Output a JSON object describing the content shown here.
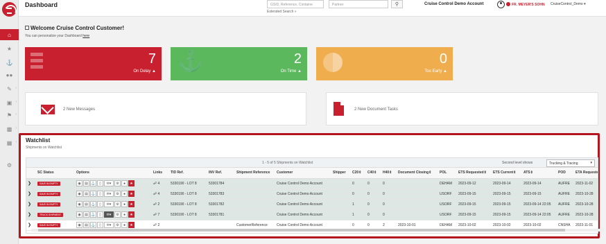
{
  "header": {
    "title": "Dashboard",
    "search_placeholder": "GSID, Reference, Containe",
    "partner_placeholder": "Partner",
    "extended_search": "Extended Search »",
    "account_name": "Cruise Control Demo Account",
    "brand": "FR. MEYER'S SOHN",
    "user": "CruiseControl_Demo"
  },
  "welcome": {
    "title": "Welcome Cruise Control Customer!",
    "subtitle": "You can personalize your Dashboard ",
    "link": "here"
  },
  "tiles": [
    {
      "value": "7",
      "label": "On Delay",
      "color": "#c8202f"
    },
    {
      "value": "2",
      "label": "On Time",
      "color": "#5cb85c"
    },
    {
      "value": "0",
      "label": "Too Early",
      "color": "#f0ad4e"
    }
  ],
  "messages": {
    "new_messages": "2 New Messages",
    "new_tasks": "2 New Document Tasks"
  },
  "watchlist": {
    "title": "Watchlist",
    "subtitle": "Shipments on Watchlist",
    "summary": "1 - 5 of 5 Shipments on Watchlist",
    "second_level_label": "Second level shows",
    "second_level_value": "Trucking & Tracing",
    "columns": [
      "SC Status",
      "Options",
      "Links",
      "TID Ref.",
      "INV Ref.",
      "Shipment Reference",
      "Customer",
      "Shipper",
      "C20⇕",
      "C40⇕",
      "H40⇕",
      "Document Closing⇕",
      "POL",
      "ETS Requested⇕",
      "ETS Current⇕",
      "ATS⇕",
      "POD",
      "ETA Requeste"
    ],
    "rows": [
      {
        "status": "SAVE IN EMPTY",
        "links": "4",
        "tid": "5330190 - LOT 8",
        "inv": "53301784",
        "shipment_ref": "",
        "customer": "Cruise Control Demo Account",
        "shipper": "",
        "c20": "0",
        "c40": "0",
        "h40": "0",
        "doc_closing": "",
        "pol": "DEHAM",
        "ets_req": "2023-09-12",
        "ets_cur": "2023-09-14",
        "ats": "2023-09-14",
        "pod": "AUFRE",
        "eta_req": "2023-11-02"
      },
      {
        "status": "SAVE IN EMPTY",
        "links": "4",
        "tid": "5330190 - LOT 8",
        "inv": "53301783",
        "shipment_ref": "",
        "customer": "Cruise Control Demo Account",
        "shipper": "",
        "c20": "0",
        "c40": "0",
        "h40": "0",
        "doc_closing": "",
        "pol": "USORF",
        "ets_req": "2023-09-15",
        "ets_cur": "2023-09-15",
        "ats": "2023-09-15",
        "pod": "AUFRE",
        "eta_req": "2023-10-28"
      },
      {
        "status": "SAVE IN EMPTY",
        "links": "2",
        "tid": "5330190 - LOT 8",
        "inv": "53301782",
        "shipment_ref": "",
        "customer": "Cruise Control Demo Account",
        "shipper": "",
        "c20": "1",
        "c40": "0",
        "h40": "0",
        "doc_closing": "",
        "pol": "USORF",
        "ets_req": "2023-09-15",
        "ets_cur": "2023-09-15",
        "ats": "2023-09-14 22:05",
        "pod": "AUFRE",
        "eta_req": "2023-10-28"
      },
      {
        "status": "TRUCK SHIPMENT",
        "links": "7",
        "tid": "5330190 - LOT 8",
        "inv": "53301781",
        "shipment_ref": "",
        "customer": "Cruise Control Demo Account",
        "shipper": "",
        "c20": "1",
        "c40": "0",
        "h40": "0",
        "doc_closing": "",
        "pol": "USORF",
        "ets_req": "2023-09-15",
        "ets_cur": "2023-09-15",
        "ats": "2023-09-14 22:05",
        "pod": "AUFRE",
        "eta_req": "2023-10-28"
      },
      {
        "status": "SAVE IN EMPTY",
        "links": "2",
        "tid": "",
        "inv": "",
        "shipment_ref": "CustomerReference",
        "customer": "Cruise Control Demo Account",
        "shipper": "",
        "c20": "0",
        "c40": "0",
        "h40": "2",
        "doc_closing": "2023-10-01",
        "pol": "DEHAM",
        "ets_req": "2023-10-02",
        "ets_cur": "2023-10-02",
        "ats": "2023-10-02",
        "pod": "CNSHA",
        "eta_req": "2023-11-01"
      }
    ]
  },
  "sidebar_icons": [
    "dashboard-icon",
    "star-icon",
    "anchor-icon",
    "group-icon",
    "edit-icon",
    "inbox-icon",
    "flag-icon",
    "chart-icon",
    "calendar-icon",
    "settings-icon"
  ]
}
